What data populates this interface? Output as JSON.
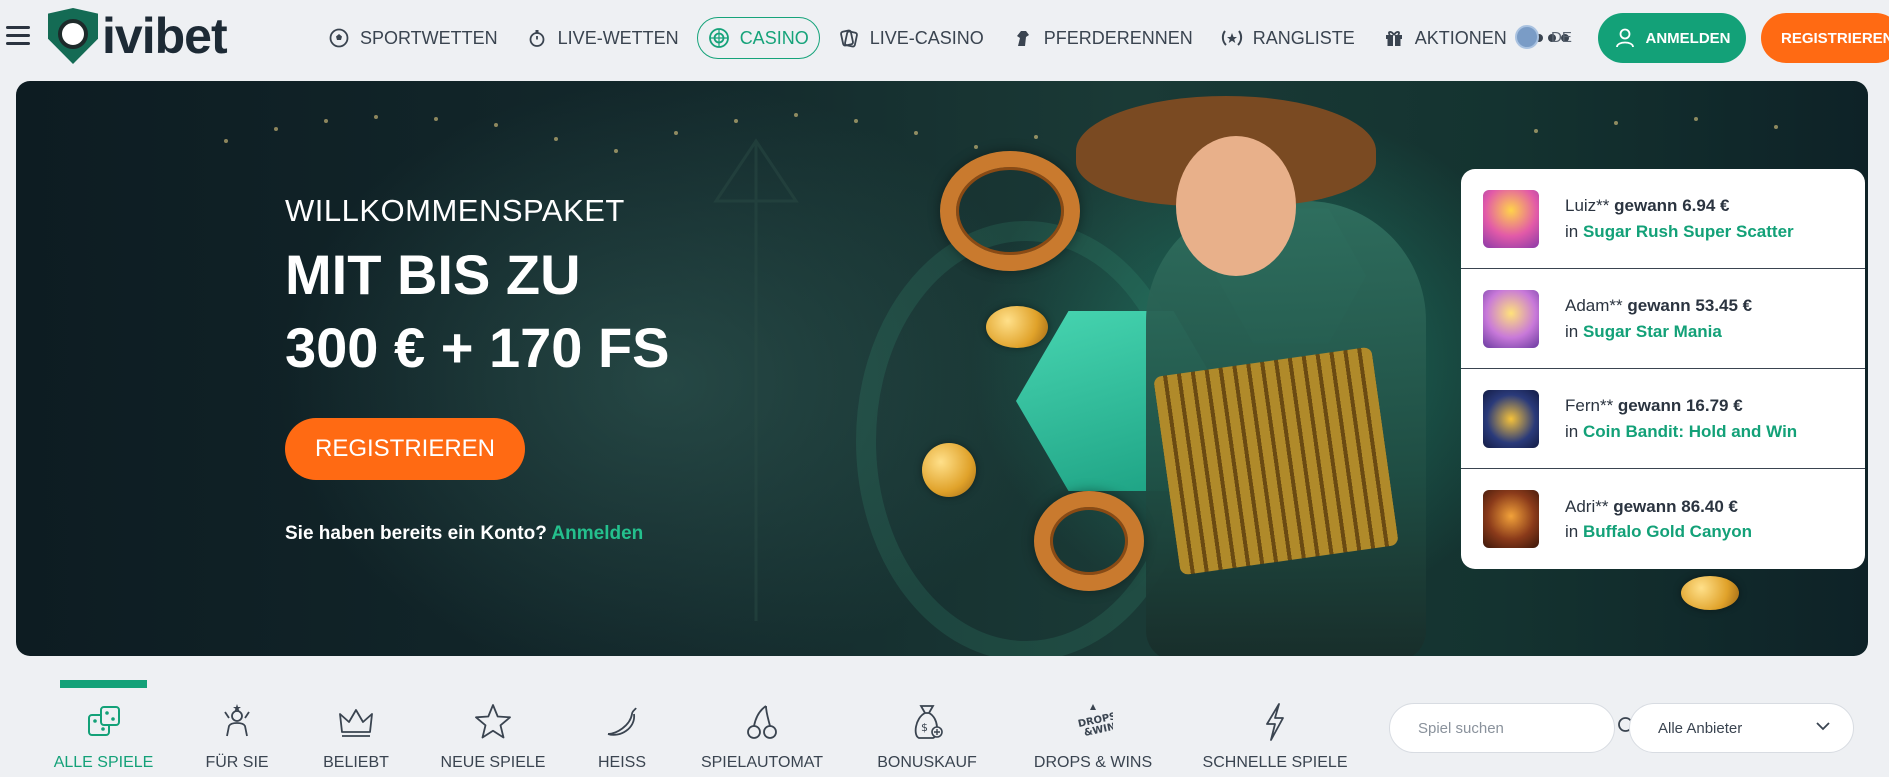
{
  "brand": {
    "name": "ivibet"
  },
  "nav": {
    "items": [
      {
        "label": "SPORTWETTEN",
        "icon": "soccer-ball-icon"
      },
      {
        "label": "LIVE-WETTEN",
        "icon": "stopwatch-icon"
      },
      {
        "label": "CASINO",
        "icon": "roulette-icon",
        "active": true
      },
      {
        "label": "LIVE-CASINO",
        "icon": "cards-icon"
      },
      {
        "label": "PFERDERENNEN",
        "icon": "horse-icon"
      },
      {
        "label": "RANGLISTE",
        "icon": "laurel-icon"
      },
      {
        "label": "AKTIONEN",
        "icon": "gift-icon"
      }
    ],
    "more_icon": "more-dots-icon"
  },
  "header": {
    "language": "DE",
    "login_label": "ANMELDEN",
    "register_label": "REGISTRIEREN"
  },
  "hero": {
    "kicker": "WILLKOMMENSPAKET",
    "title_line1": "MIT BIS ZU",
    "title_line2": "300 € + 170 FS",
    "cta": "REGISTRIEREN",
    "account_prompt": "Sie haben bereits ein Konto?",
    "account_link": "Anmelden"
  },
  "winners": [
    {
      "user": "Luiz**",
      "verb": "gewann",
      "amount": "6.94 €",
      "in": "in",
      "game": "Sugar Rush Super Scatter",
      "thumb_color": "#e25aa8"
    },
    {
      "user": "Adam**",
      "verb": "gewann",
      "amount": "53.45 €",
      "in": "in",
      "game": "Sugar Star Mania",
      "thumb_color": "#c879d9"
    },
    {
      "user": "Fern**",
      "verb": "gewann",
      "amount": "16.79 €",
      "in": "in",
      "game": "Coin Bandit: Hold and Win",
      "thumb_color": "#2a3a7a"
    },
    {
      "user": "Adri**",
      "verb": "gewann",
      "amount": "86.40 €",
      "in": "in",
      "game": "Buffalo Gold Canyon",
      "thumb_color": "#8a3a1a"
    }
  ],
  "categories": [
    {
      "label": "ALLE SPIELE",
      "icon": "dice-icon",
      "active": true
    },
    {
      "label": "FÜR SIE",
      "icon": "person-star-icon"
    },
    {
      "label": "BELIEBT",
      "icon": "crown-icon"
    },
    {
      "label": "NEUE SPIELE",
      "icon": "star-icon"
    },
    {
      "label": "HEISS",
      "icon": "chili-icon"
    },
    {
      "label": "SPIELAUTOMAT",
      "icon": "cherry-icon"
    },
    {
      "label": "BONUSKAUF",
      "icon": "money-bag-icon"
    },
    {
      "label": "DROPS & WINS",
      "icon": "drops-wins-icon"
    },
    {
      "label": "SCHNELLE SPIELE",
      "icon": "lightning-icon"
    }
  ],
  "search": {
    "placeholder": "Spiel suchen"
  },
  "provider": {
    "value": "Alle Anbieter"
  },
  "colors": {
    "accent": "#13a178",
    "cta": "#ff6a13",
    "text": "#2b3440"
  }
}
